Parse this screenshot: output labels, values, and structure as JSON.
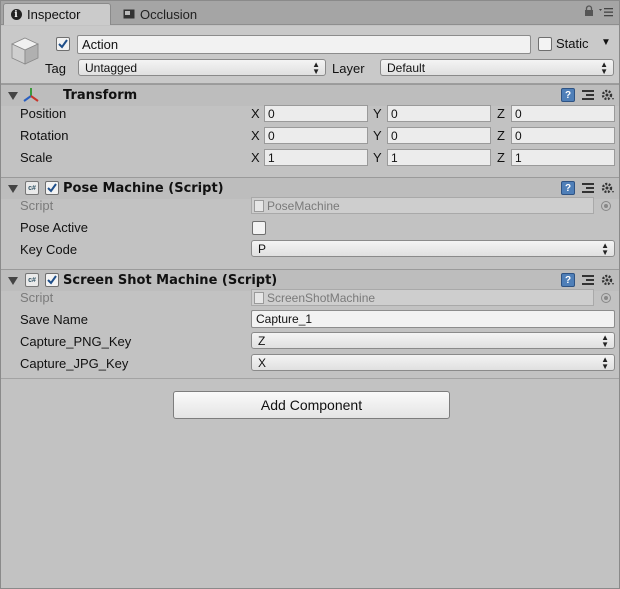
{
  "tabs": [
    {
      "label": "Inspector",
      "icon": "info-icon"
    },
    {
      "label": "Occlusion",
      "icon": "occlusion-icon"
    }
  ],
  "header": {
    "name": "Action",
    "static_label": "Static",
    "tag_label": "Tag",
    "tag_value": "Untagged",
    "layer_label": "Layer",
    "layer_value": "Default",
    "active": true
  },
  "transform": {
    "title": "Transform",
    "rows": [
      {
        "label": "Position",
        "x": "0",
        "y": "0",
        "z": "0"
      },
      {
        "label": "Rotation",
        "x": "0",
        "y": "0",
        "z": "0"
      },
      {
        "label": "Scale",
        "x": "1",
        "y": "1",
        "z": "1"
      }
    ],
    "axes": [
      "X",
      "Y",
      "Z"
    ]
  },
  "pose_machine": {
    "title": "Pose Machine (Script)",
    "script_label": "Script",
    "script_value": "PoseMachine",
    "pose_active_label": "Pose Active",
    "pose_active": false,
    "key_code_label": "Key Code",
    "key_code_value": "P"
  },
  "screenshot_machine": {
    "title": "Screen Shot Machine (Script)",
    "script_label": "Script",
    "script_value": "ScreenShotMachine",
    "save_name_label": "Save Name",
    "save_name_value": "Capture_1",
    "png_key_label": "Capture_PNG_Key",
    "png_key_value": "Z",
    "jpg_key_label": "Capture_JPG_Key",
    "jpg_key_value": "X"
  },
  "add_component_label": "Add Component",
  "colors": {
    "panel": "#c2c2c2",
    "help_icon": "#4f7fb8",
    "checkmark": "#1f4f8a"
  }
}
